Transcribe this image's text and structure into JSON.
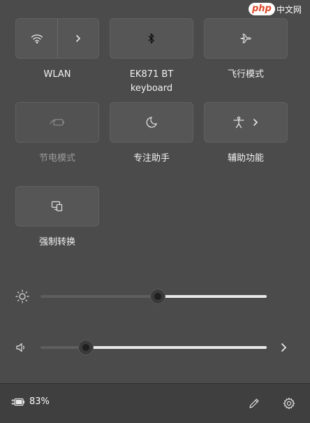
{
  "watermark": {
    "logo": "php",
    "text": "中文网"
  },
  "tiles": {
    "wlan": {
      "label": "WLAN"
    },
    "bluetooth": {
      "label_line1": "EK871 BT",
      "label_line2": "keyboard"
    },
    "airplane": {
      "label": "飞行模式"
    },
    "battery_saver": {
      "label": "节电模式"
    },
    "focus_assist": {
      "label": "专注助手"
    },
    "accessibility": {
      "label": "辅助功能"
    },
    "cast": {
      "label": "强制转换"
    }
  },
  "sliders": {
    "brightness": {
      "value": 0.52
    },
    "volume": {
      "value": 0.2
    }
  },
  "footer": {
    "battery_percent": "83%"
  },
  "colors": {
    "track_filled": "#e8e8e8",
    "track_empty": "#5e5e5e",
    "disabled": "#9a9a9a"
  }
}
